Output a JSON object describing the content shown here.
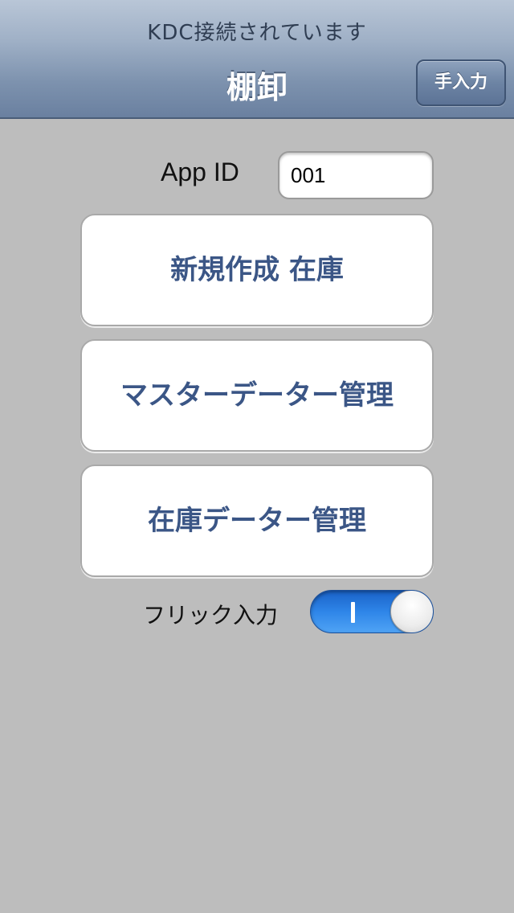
{
  "header": {
    "status": "KDC接続されています",
    "title": "棚卸",
    "manual_input_label": "手入力"
  },
  "form": {
    "app_id_label": "App ID",
    "app_id_value": "001"
  },
  "menu": {
    "new_inventory_label": "新規作成 在庫",
    "master_data_label": "マスターデーター管理",
    "inventory_data_label": "在庫データー管理"
  },
  "flick": {
    "label": "フリック入力",
    "enabled": true
  },
  "colors": {
    "background": "#bdbdbd",
    "button_text": "#3b5686",
    "toggle_on": "#2e85e8"
  }
}
